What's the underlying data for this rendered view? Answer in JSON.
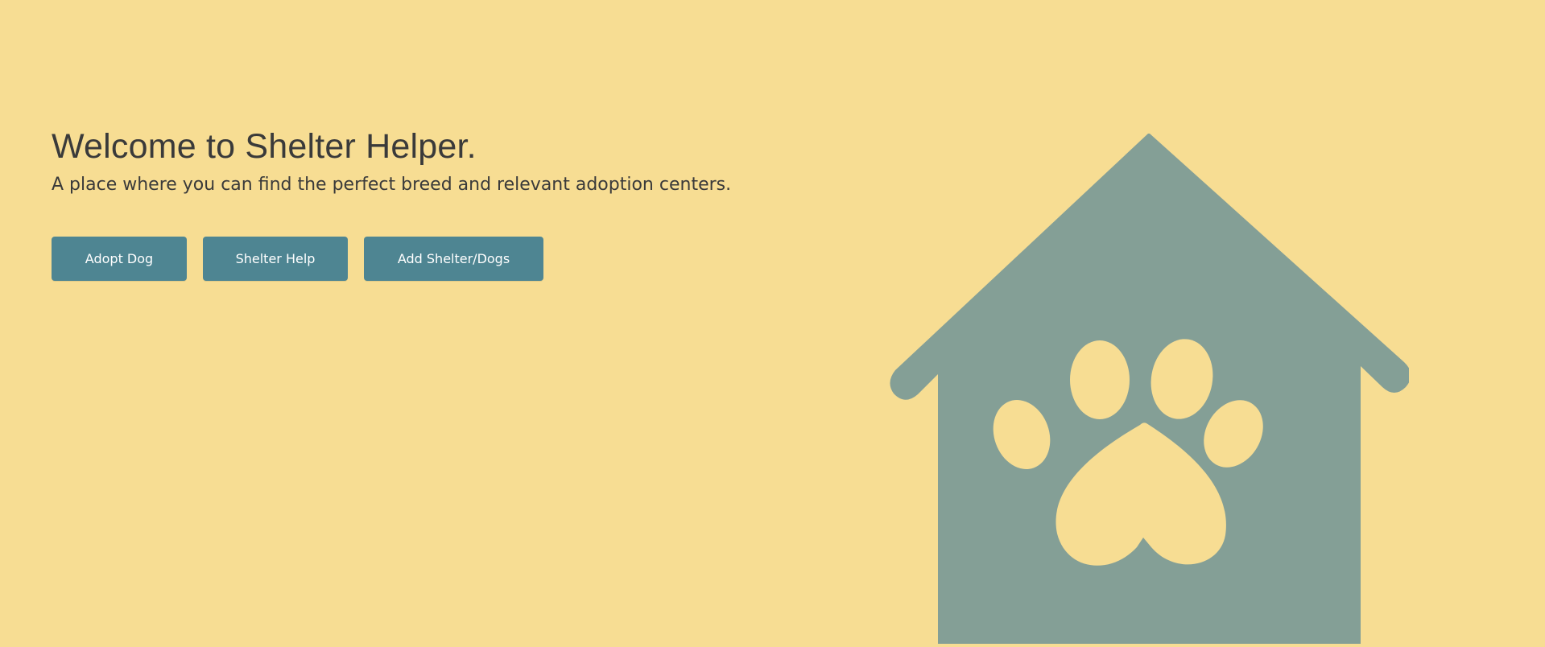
{
  "hero": {
    "title": "Welcome to Shelter Helper.",
    "subtitle": "A place where you can find the perfect breed and relevant adoption centers."
  },
  "actions": {
    "adopt_label": "Adopt Dog",
    "help_label": "Shelter Help",
    "add_label": "Add Shelter/Dogs"
  },
  "illustration": {
    "icon": "dog-house-paw-icon"
  },
  "colors": {
    "background": "#f7dd93",
    "button": "#4e8592",
    "house": "#849f96",
    "text": "#3a3a3a"
  }
}
